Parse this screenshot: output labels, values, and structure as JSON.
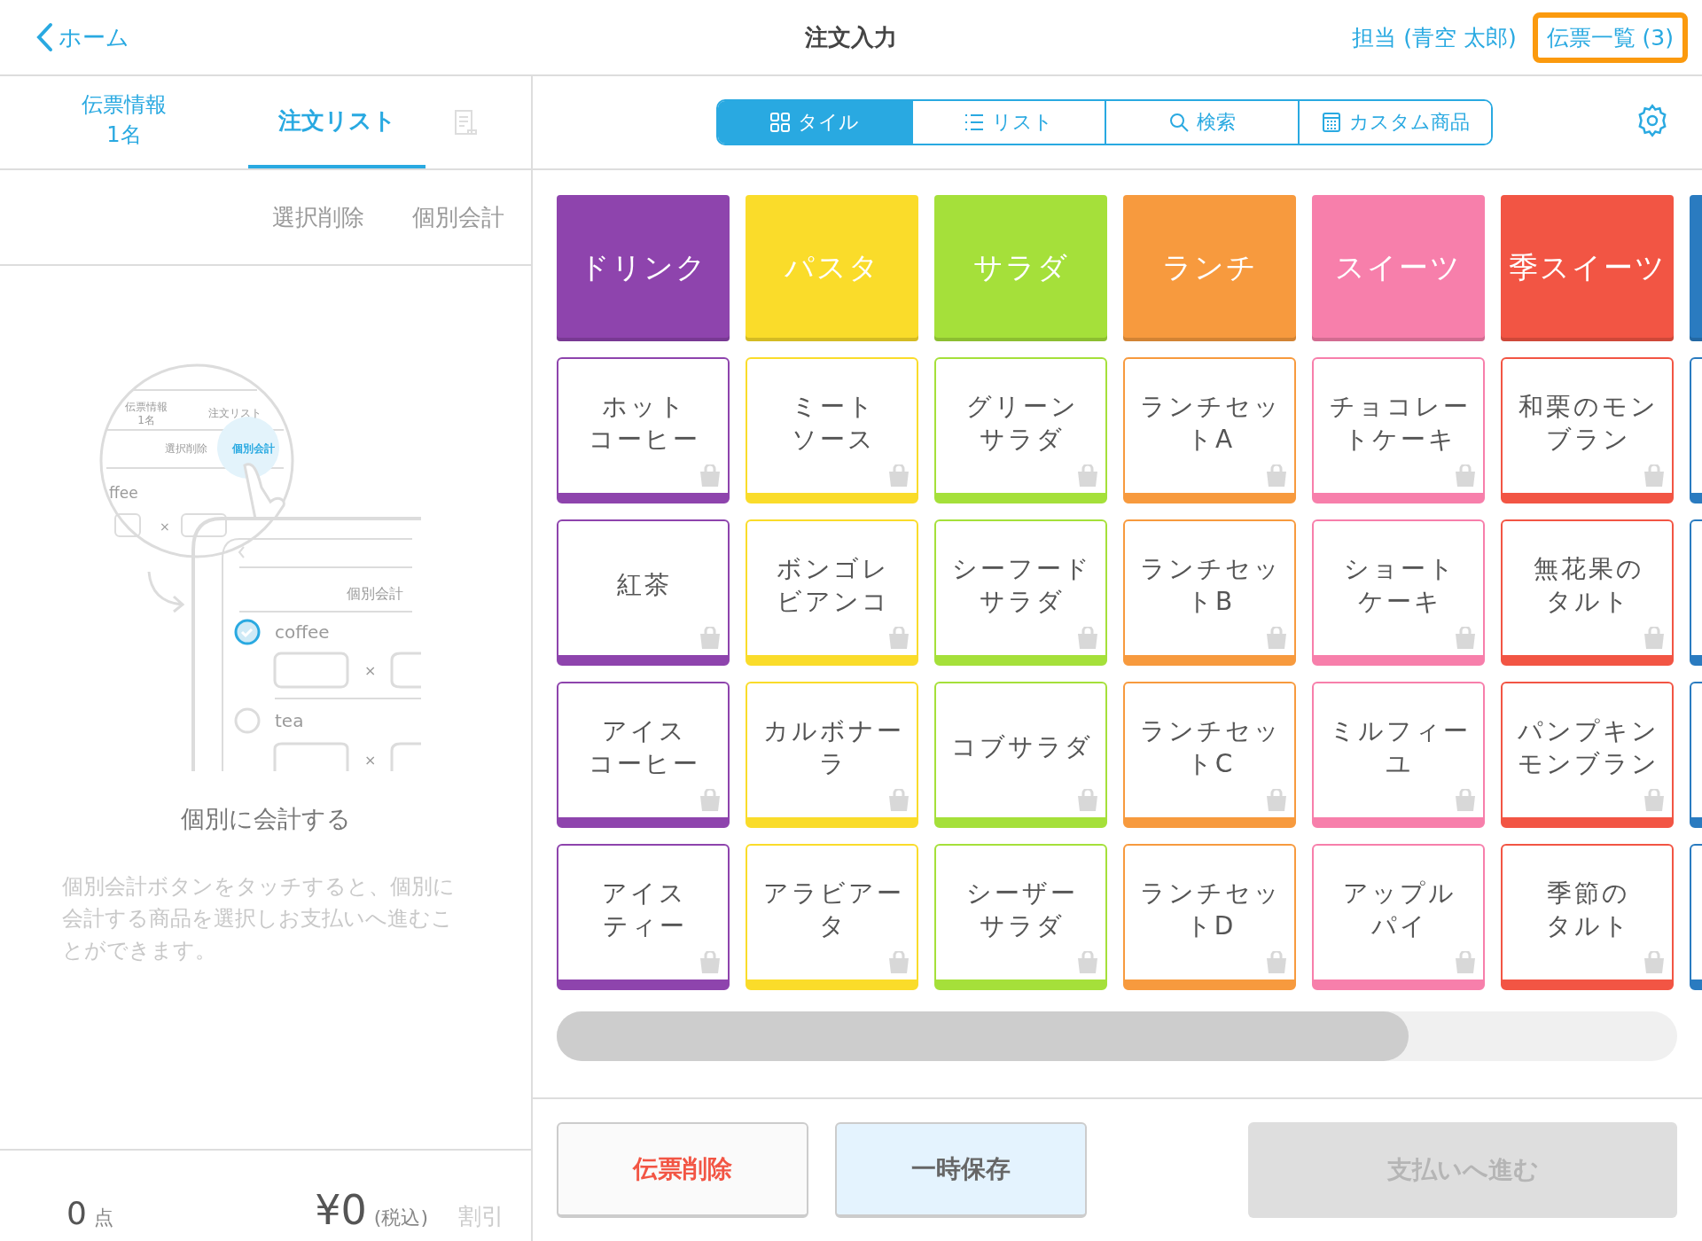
{
  "header": {
    "back": "ホーム",
    "title": "注文入力",
    "staff": "担当 (青空 太郎)",
    "slips": {
      "label": "伝票一覧 (3)",
      "highlighted": true
    }
  },
  "left_tabs": [
    {
      "label": "伝票情報\n1名",
      "selected": false
    },
    {
      "label": "注文リスト",
      "selected": true
    }
  ],
  "actions": [
    "選択削除",
    "個別会計"
  ],
  "illustration": {
    "mini_tabs": [
      "伝票情報",
      "1名",
      "注文リスト"
    ],
    "mini_actions": [
      "選択削除",
      "個別会計"
    ],
    "partial_item": "ffee",
    "screen_action": "個別会計",
    "items": [
      {
        "name": "coffee",
        "checked": true
      },
      {
        "name": "tea",
        "checked": false
      }
    ],
    "times": "×"
  },
  "empty_title": "個別に会計する",
  "empty_text": "個別会計ボタンをタッチすると、個別に会計する商品を選択しお支払いへ進むことができます。",
  "footer": {
    "count": "0",
    "count_unit": "点",
    "total": "¥0",
    "tax": "(税込)",
    "discount": "割引"
  },
  "view_modes": [
    {
      "label": "タイル",
      "selected": true
    },
    {
      "label": "リスト",
      "selected": false
    },
    {
      "label": "検索",
      "selected": false
    },
    {
      "label": "カスタム商品",
      "selected": false
    }
  ],
  "categories": [
    {
      "label": "ドリンク",
      "color": "#8e44ad",
      "items": [
        [
          "ホット",
          "コーヒー"
        ],
        [
          "紅茶"
        ],
        [
          "アイス",
          "コーヒー"
        ],
        [
          "アイス",
          "ティー"
        ]
      ]
    },
    {
      "label": "パスタ",
      "color": "#fadc2a",
      "items": [
        [
          "ミート",
          "ソース"
        ],
        [
          "ボンゴレ",
          "ビアンコ"
        ],
        [
          "カルボナー",
          "ラ"
        ],
        [
          "アラビアー",
          "タ"
        ]
      ]
    },
    {
      "label": "サラダ",
      "color": "#a5e03a",
      "items": [
        [
          "グリーン",
          "サラダ"
        ],
        [
          "シーフード",
          "サラダ"
        ],
        [
          "コブサラダ"
        ],
        [
          "シーザー",
          "サラダ"
        ]
      ]
    },
    {
      "label": "ランチ",
      "color": "#f79a3e",
      "items": [
        [
          "ランチセッ",
          "トA"
        ],
        [
          "ランチセッ",
          "トB"
        ],
        [
          "ランチセッ",
          "トC"
        ],
        [
          "ランチセッ",
          "トD"
        ]
      ]
    },
    {
      "label": "スイーツ",
      "color": "#f77fab",
      "items": [
        [
          "チョコレー",
          "トケーキ"
        ],
        [
          "ショート",
          "ケーキ"
        ],
        [
          "ミルフィー",
          "ユ"
        ],
        [
          "アップル",
          "パイ"
        ]
      ]
    },
    {
      "label": "季スイーツ",
      "color": "#f25544",
      "items": [
        [
          "和栗のモン",
          "ブラン"
        ],
        [
          "無花果の",
          "タルト"
        ],
        [
          "パンプキン",
          "モンブラン"
        ],
        [
          "季節の",
          "タルト"
        ]
      ]
    },
    {
      "color": "#2a7bc0"
    }
  ],
  "buttons": [
    {
      "label": "伝票削除",
      "kind": "danger",
      "disabled": false
    },
    {
      "label": "一時保存",
      "kind": "save",
      "disabled": false
    },
    {
      "label": "支払いへ進む",
      "kind": "primary",
      "disabled": true
    }
  ]
}
